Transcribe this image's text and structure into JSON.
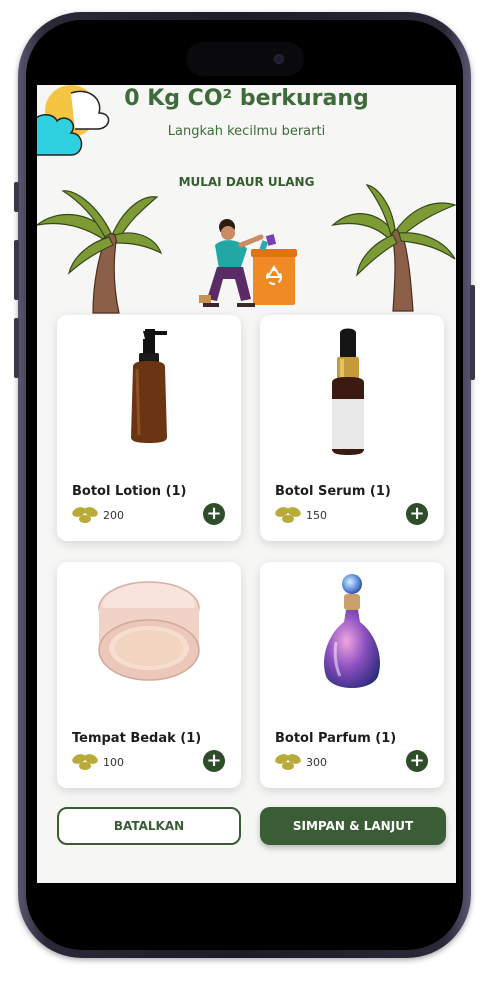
{
  "header": {
    "title": "0 Kg CO² berkurang",
    "subtitle": "Langkah kecilmu berarti",
    "cta": "MULAI DAUR ULANG"
  },
  "products": [
    {
      "name": "Botol Lotion (1)",
      "points": "200",
      "icon": "lotion-bottle-icon"
    },
    {
      "name": "Botol Serum (1)",
      "points": "150",
      "icon": "serum-bottle-icon"
    },
    {
      "name": "Tempat Bedak (1)",
      "points": "100",
      "icon": "powder-compact-icon"
    },
    {
      "name": "Botol Parfum (1)",
      "points": "300",
      "icon": "perfume-bottle-icon"
    }
  ],
  "actions": {
    "cancel_label": "BATALKAN",
    "save_label": "SIMPAN & LANJUT"
  },
  "colors": {
    "primary": "#3a5d36",
    "title": "#3e6b3a",
    "leaf_points": "#b8ab3a",
    "background": "#f6f6f4"
  }
}
